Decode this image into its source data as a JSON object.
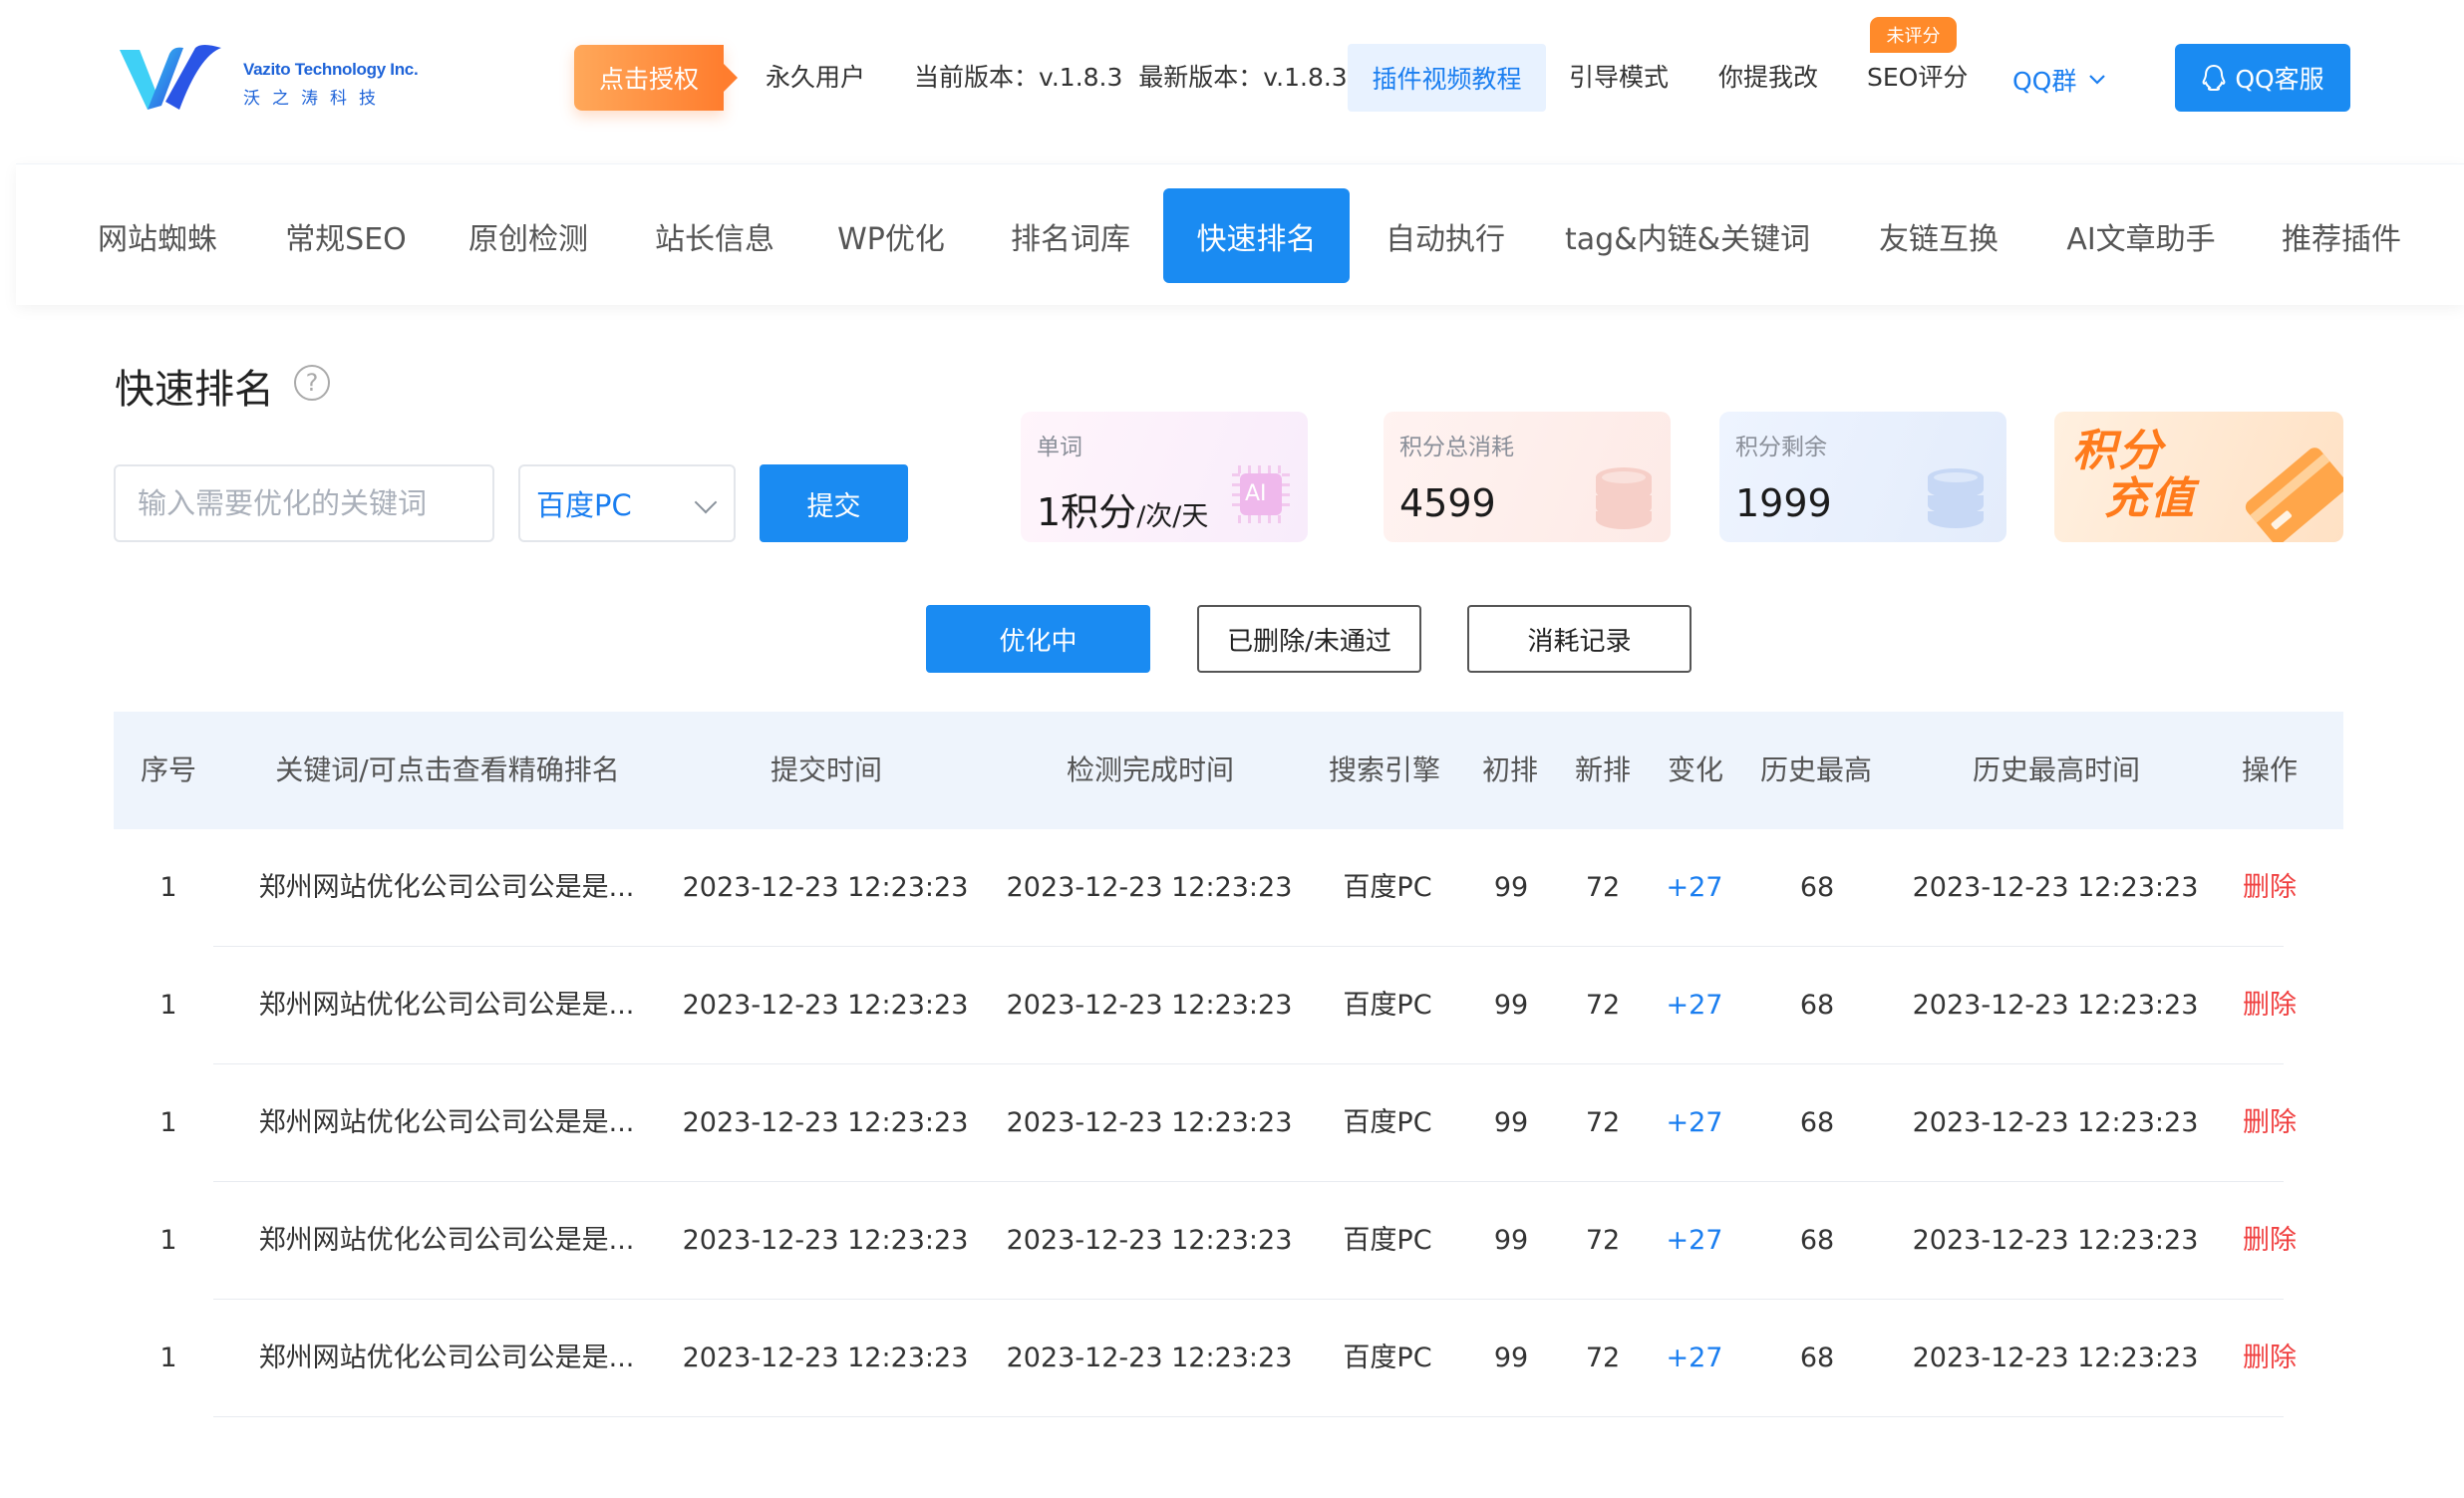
{
  "header": {
    "logo_en": "Vazito Technology Inc.",
    "logo_cn": "沃之涛科技",
    "auth_button": "点击授权",
    "user_type": "永久用户",
    "version_text": "当前版本：v.1.8.3  最新版本：v.1.8.3",
    "video_tutorial": "插件视频教程",
    "guide_mode": "引导模式",
    "feedback": "你提我改",
    "seo_score": "SEO评分",
    "seo_badge": "未评分",
    "qq_group": "QQ群",
    "qq_service": "QQ客服"
  },
  "tabs": [
    {
      "label": "网站蜘蛛"
    },
    {
      "label": "常规SEO"
    },
    {
      "label": "原创检测"
    },
    {
      "label": "站长信息"
    },
    {
      "label": "WP优化"
    },
    {
      "label": "排名词库"
    },
    {
      "label": "快速排名",
      "active": true
    },
    {
      "label": "自动执行"
    },
    {
      "label": "tag&内链&关键词"
    },
    {
      "label": "友链互换"
    },
    {
      "label": "AI文章助手"
    },
    {
      "label": "推荐插件"
    }
  ],
  "page": {
    "title": "快速排名",
    "help_glyph": "?"
  },
  "form": {
    "keyword_placeholder": "输入需要优化的关键词",
    "engine_selected": "百度PC",
    "submit_label": "提交"
  },
  "cards": {
    "per_word_label": "单词",
    "per_word_value": "1积分",
    "per_word_unit": "/次/天",
    "ai_badge": "AI",
    "total_used_label": "积分总消耗",
    "total_used_value": "4599",
    "remaining_label": "积分剩余",
    "remaining_value": "1999",
    "recharge_line1": "积分",
    "recharge_line2": "充值"
  },
  "status_tabs": {
    "optimizing": "优化中",
    "deleted": "已删除/未通过",
    "records": "消耗记录"
  },
  "table": {
    "headers": {
      "index": "序号",
      "keyword": "关键词/可点击查看精确排名",
      "submit_time": "提交时间",
      "done_time": "检测完成时间",
      "engine": "搜索引擎",
      "initial": "初排",
      "new": "新排",
      "change": "变化",
      "best": "历史最高",
      "best_time": "历史最高时间",
      "action": "操作"
    },
    "rows": [
      {
        "index": "1",
        "keyword": "郑州网站优化公司公司公是是...",
        "submit_time": "2023-12-23 12:23:23",
        "done_time": "2023-12-23 12:23:23",
        "engine": "百度PC",
        "initial": "99",
        "new": "72",
        "change": "+27",
        "best": "68",
        "best_time": "2023-12-23 12:23:23",
        "action": "删除"
      },
      {
        "index": "1",
        "keyword": "郑州网站优化公司公司公是是...",
        "submit_time": "2023-12-23 12:23:23",
        "done_time": "2023-12-23 12:23:23",
        "engine": "百度PC",
        "initial": "99",
        "new": "72",
        "change": "+27",
        "best": "68",
        "best_time": "2023-12-23 12:23:23",
        "action": "删除"
      },
      {
        "index": "1",
        "keyword": "郑州网站优化公司公司公是是...",
        "submit_time": "2023-12-23 12:23:23",
        "done_time": "2023-12-23 12:23:23",
        "engine": "百度PC",
        "initial": "99",
        "new": "72",
        "change": "+27",
        "best": "68",
        "best_time": "2023-12-23 12:23:23",
        "action": "删除"
      },
      {
        "index": "1",
        "keyword": "郑州网站优化公司公司公是是...",
        "submit_time": "2023-12-23 12:23:23",
        "done_time": "2023-12-23 12:23:23",
        "engine": "百度PC",
        "initial": "99",
        "new": "72",
        "change": "+27",
        "best": "68",
        "best_time": "2023-12-23 12:23:23",
        "action": "删除"
      },
      {
        "index": "1",
        "keyword": "郑州网站优化公司公司公是是...",
        "submit_time": "2023-12-23 12:23:23",
        "done_time": "2023-12-23 12:23:23",
        "engine": "百度PC",
        "initial": "99",
        "new": "72",
        "change": "+27",
        "best": "68",
        "best_time": "2023-12-23 12:23:23",
        "action": "删除"
      }
    ]
  },
  "colors": {
    "primary": "#1a8bf2",
    "link": "#1a7ef0",
    "danger": "#f04040",
    "accent_orange": "#ff7d2e"
  }
}
